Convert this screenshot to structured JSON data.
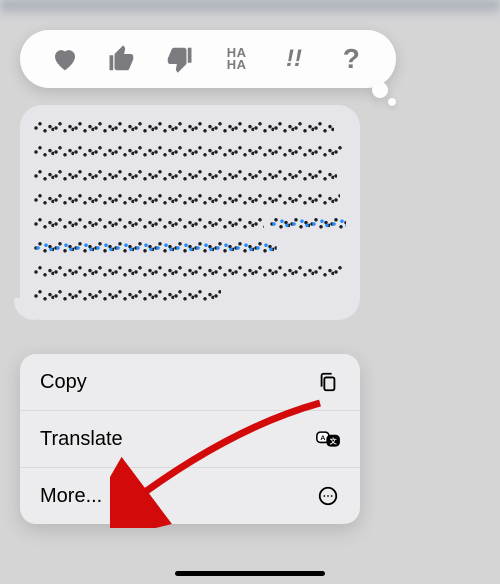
{
  "tapbacks": {
    "heart": "heart",
    "thumbs_up": "thumbs-up",
    "thumbs_down": "thumbs-down",
    "haha": "HA HA",
    "exclaim": "!!",
    "question": "?"
  },
  "context_menu": {
    "copy": "Copy",
    "translate": "Translate",
    "more": "More..."
  }
}
